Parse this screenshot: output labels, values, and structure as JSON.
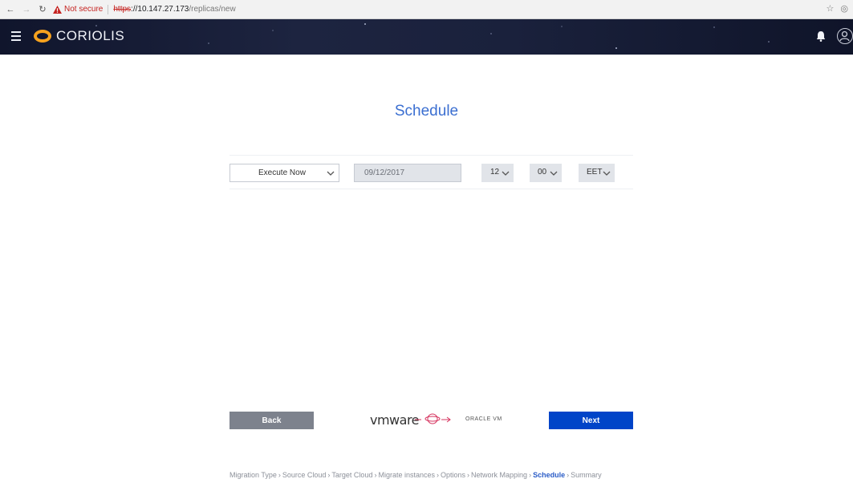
{
  "browser": {
    "not_secure": "Not secure",
    "url_scheme": "https",
    "url_host": "://10.147.27.173",
    "url_path": "/replicas/new"
  },
  "header": {
    "logo_text": "CORIOLIS",
    "icons": [
      "menu-icon",
      "coriolis-logo-icon",
      "bell-icon",
      "user-icon"
    ]
  },
  "main": {
    "title": "Schedule",
    "schedule": {
      "mode": "Execute Now",
      "date": "09/12/2017",
      "hour": "12",
      "minute": "00",
      "timezone": "EET"
    }
  },
  "footer": {
    "back_label": "Back",
    "next_label": "Next",
    "source_logo": "vmware",
    "target_logo": "ORACLE VM"
  },
  "breadcrumb": {
    "items": [
      "Migration Type",
      "Source Cloud",
      "Target Cloud",
      "Migrate instances",
      "Options",
      "Network Mapping",
      "Schedule",
      "Summary"
    ],
    "active": "Schedule"
  },
  "colors": {
    "accent": "#3b6fd1",
    "primary_button": "#0044c8",
    "secondary_button": "#7d828d",
    "logo_ring": "#f6a21e"
  }
}
